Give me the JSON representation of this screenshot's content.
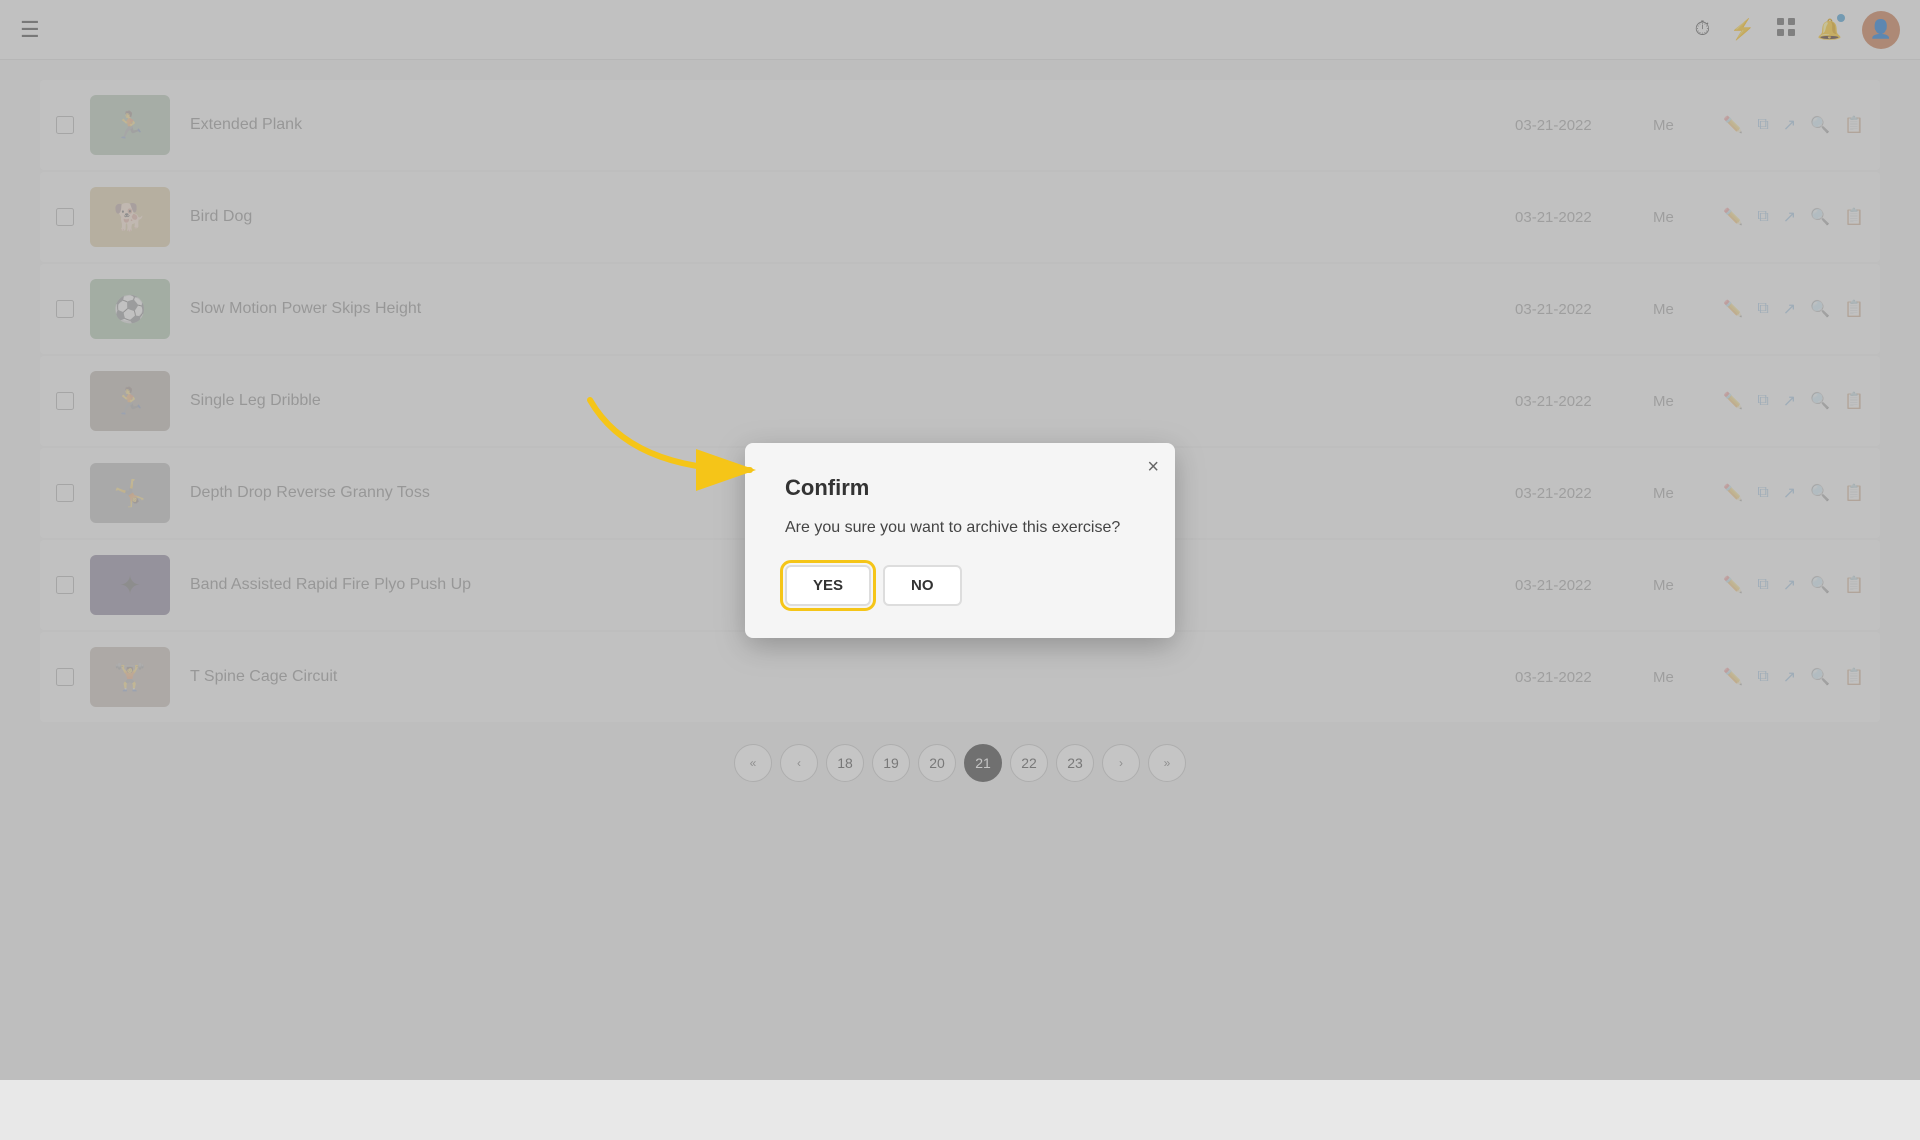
{
  "nav": {
    "hamburger": "☰",
    "icons": {
      "history": "⏱",
      "lightning": "⚡",
      "grid": "⊞",
      "bell": "🔔"
    }
  },
  "exercises": [
    {
      "id": 1,
      "name": "Extended Plank",
      "date": "03-21-2022",
      "owner": "Me",
      "thumb_type": "extended-plank",
      "thumb_emoji": "🏃"
    },
    {
      "id": 2,
      "name": "Bird Dog",
      "date": "03-21-2022",
      "owner": "Me",
      "thumb_type": "bird-dog",
      "thumb_emoji": "🐕"
    },
    {
      "id": 3,
      "name": "Slow Motion Power Skips Height",
      "date": "03-21-2022",
      "owner": "Me",
      "thumb_type": "power-skips",
      "thumb_emoji": "⚽"
    },
    {
      "id": 4,
      "name": "Single Leg Dribble",
      "date": "03-21-2022",
      "owner": "Me",
      "thumb_type": "single-leg",
      "thumb_emoji": "🏃"
    },
    {
      "id": 5,
      "name": "Depth Drop Reverse Granny Toss",
      "date": "03-21-2022",
      "owner": "Me",
      "thumb_type": "depth-drop",
      "thumb_emoji": "🤸"
    },
    {
      "id": 6,
      "name": "Band Assisted Rapid Fire Plyo Push Up",
      "date": "03-21-2022",
      "owner": "Me",
      "thumb_type": "band-assisted",
      "thumb_emoji": "✦"
    },
    {
      "id": 7,
      "name": "T Spine Cage Circuit",
      "date": "03-21-2022",
      "owner": "Me",
      "thumb_type": "t-spine",
      "thumb_emoji": "🏋"
    }
  ],
  "modal": {
    "title": "Confirm",
    "message": "Are you sure you want to archive this exercise?",
    "yes_label": "YES",
    "no_label": "NO",
    "close_label": "×"
  },
  "pagination": {
    "pages": [
      "18",
      "19",
      "20",
      "21",
      "22",
      "23"
    ],
    "current": "21",
    "prev_label": "‹",
    "next_label": "›",
    "first_label": "«",
    "last_label": "»"
  }
}
